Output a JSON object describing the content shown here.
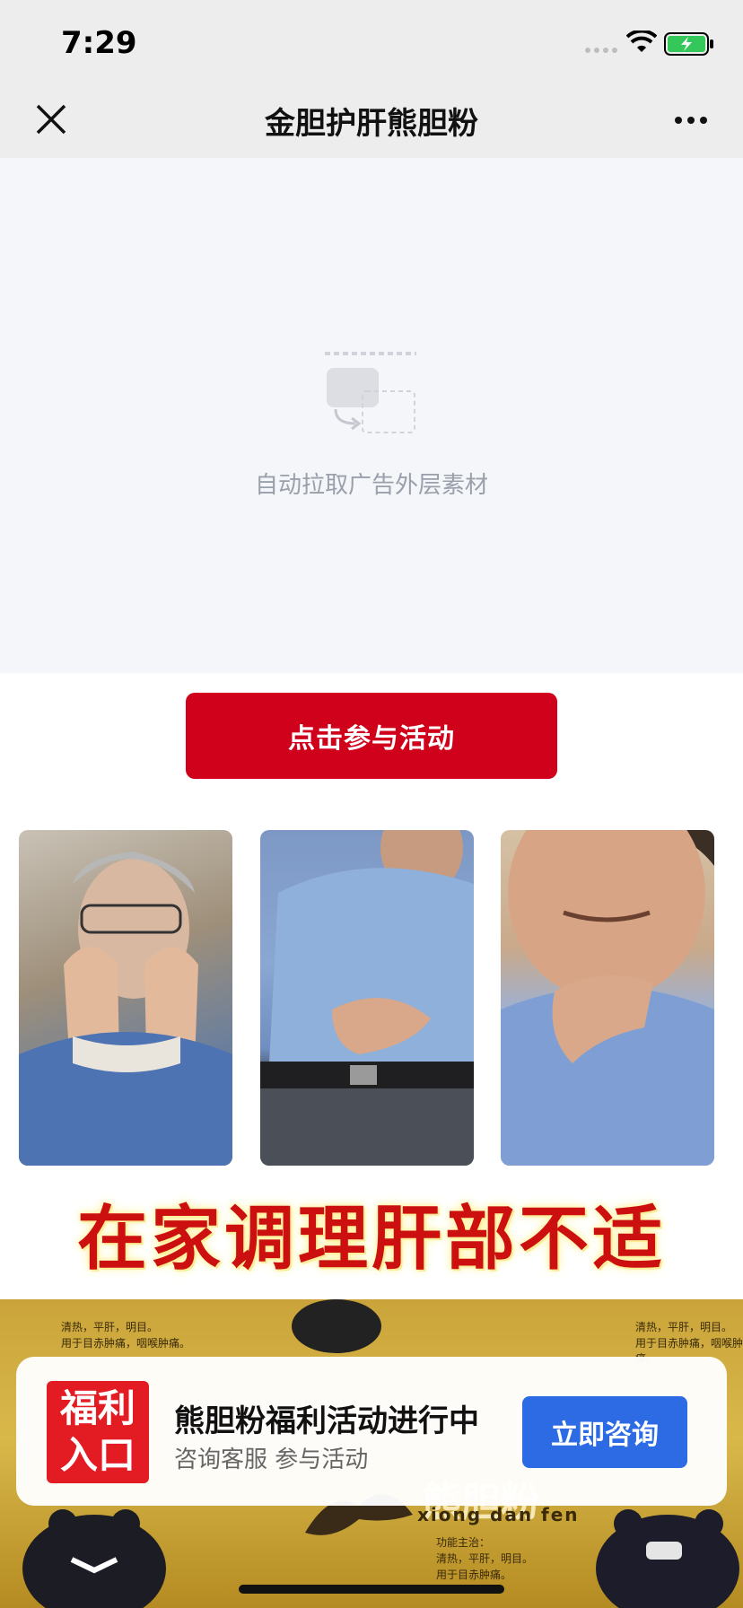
{
  "status_bar": {
    "time": "7:29"
  },
  "nav": {
    "title": "金胆护肝熊胆粉"
  },
  "placeholder": {
    "text": "自动拉取广告外层素材"
  },
  "cta": {
    "label": "点击参与活动"
  },
  "headline": {
    "text": "在家调理肝部不适"
  },
  "banner": {
    "product_name_cn": "熊胆粉",
    "product_name_pinyin": "xiong dan fen",
    "small_text_1": "清热，平肝，明目。",
    "small_text_2": "用于目赤肿痛，咽喉肿痛。",
    "small_text_3": "功能主治：",
    "small_text_4": "清热，平肝，明目。",
    "small_text_5": "用于目赤肿痛。"
  },
  "promo": {
    "badge_line1": "福利",
    "badge_line2": "入口",
    "title": "熊胆粉福利活动进行中",
    "subtitle": "咨询客服 参与活动",
    "button_label": "立即咨询"
  },
  "icons": {
    "close": "close-icon",
    "more": "more-icon",
    "signal": "signal-icon",
    "wifi": "wifi-icon",
    "battery": "battery-charging-icon"
  },
  "colors": {
    "cta_red": "#d0021b",
    "headline_red": "#cc1010",
    "consult_blue": "#2c6be3",
    "badge_red": "#e31b23"
  }
}
